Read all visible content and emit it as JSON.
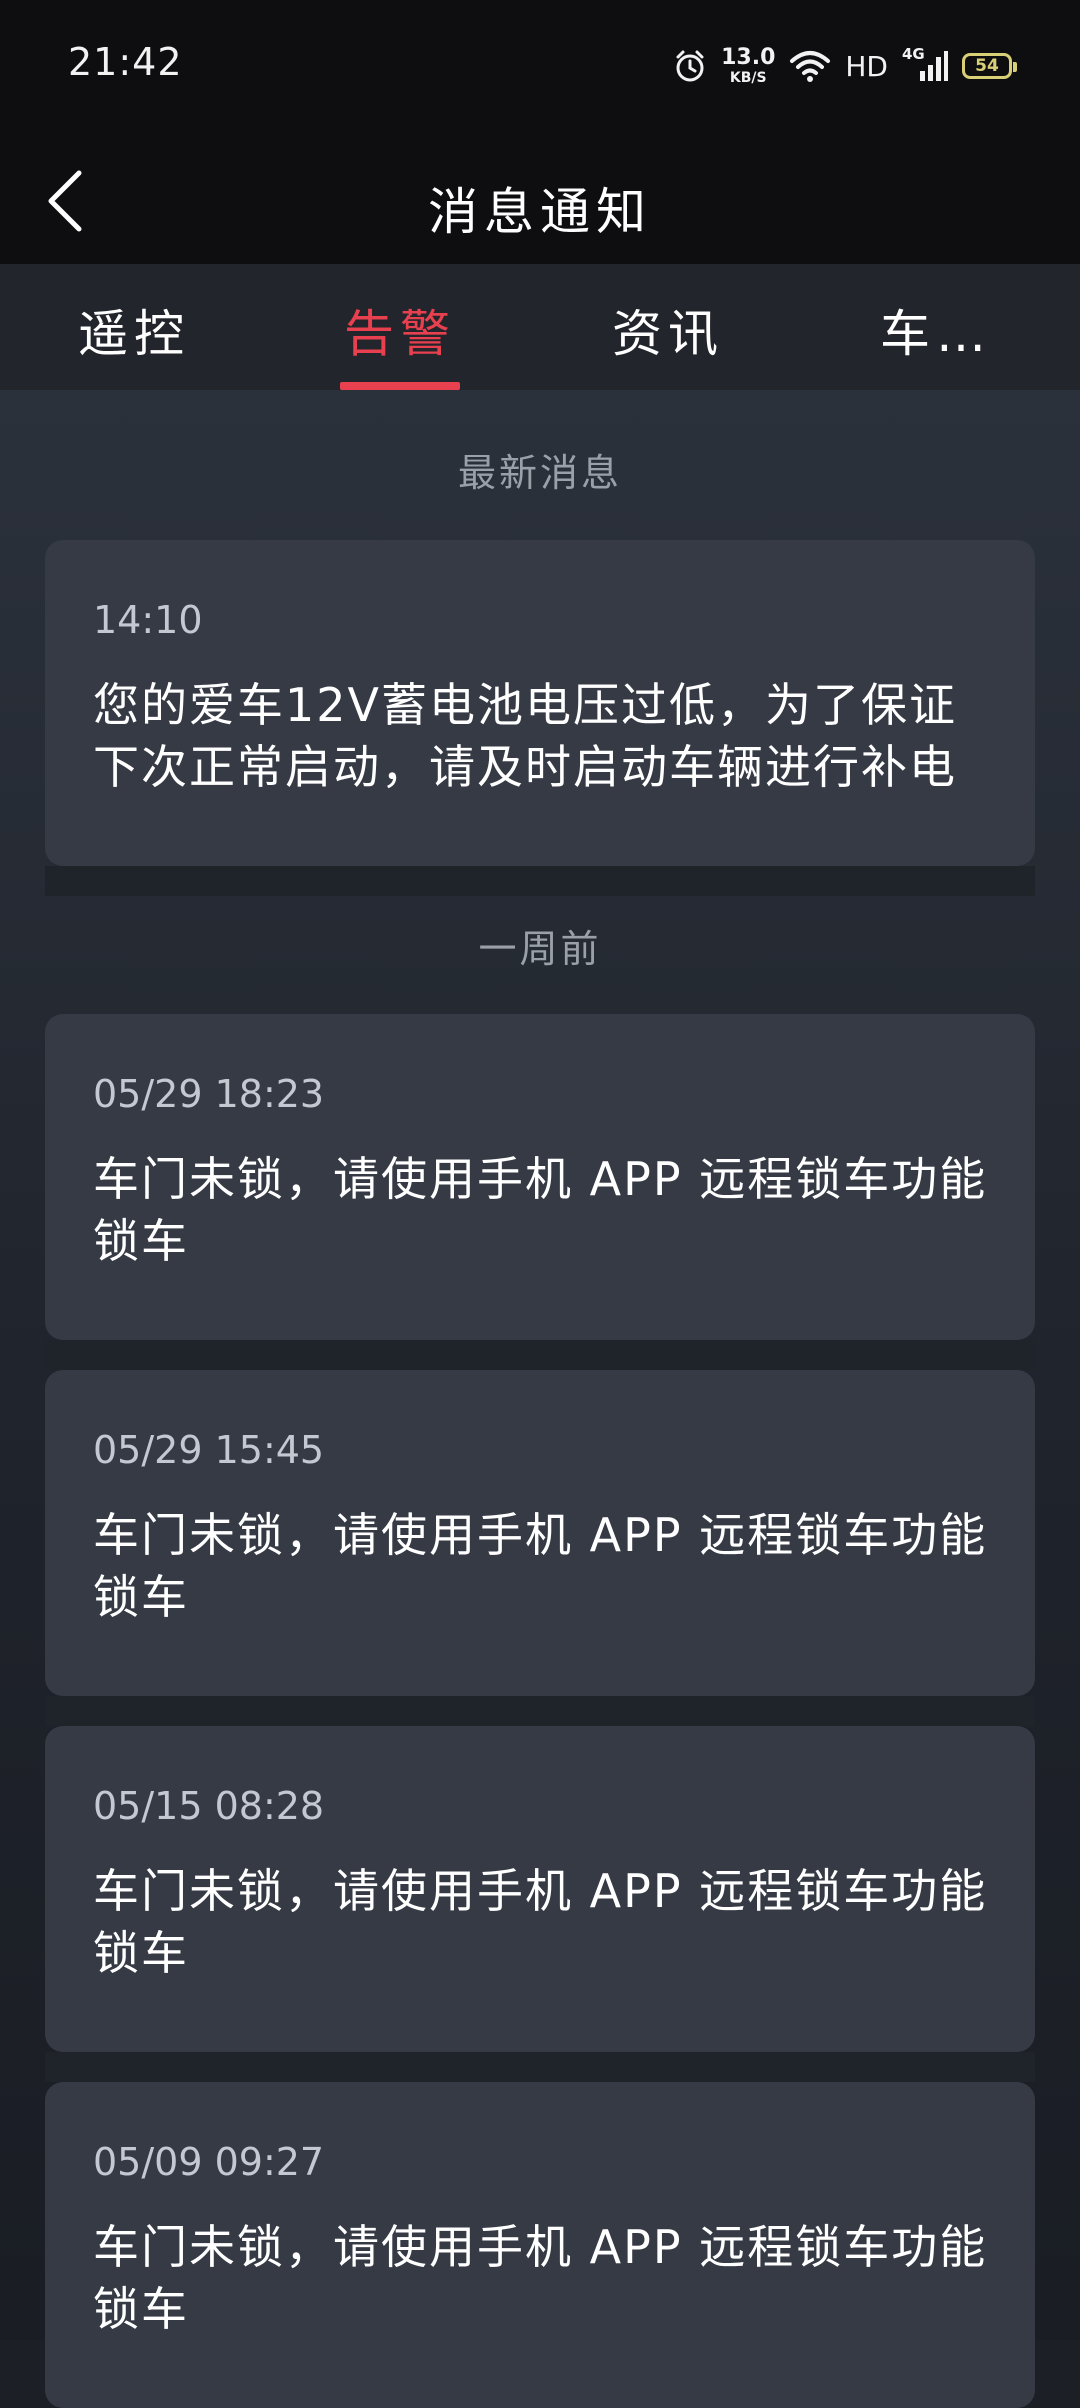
{
  "status": {
    "time": "21:42",
    "net_speed_value": "13.0",
    "net_speed_unit": "KB/S",
    "hd_label": "HD",
    "signal_label": "4G",
    "battery": "54",
    "battery_color": "#d8cf77"
  },
  "nav": {
    "title": "消息通知",
    "back_icon": "chevron-left-icon"
  },
  "tabs": [
    {
      "label": "遥控",
      "active": false
    },
    {
      "label": "告警",
      "active": true
    },
    {
      "label": "资讯",
      "active": false
    },
    {
      "label": "车…",
      "active": false
    }
  ],
  "accent_color": "#e8404f",
  "sections": [
    {
      "header": "最新消息",
      "items": [
        {
          "time": "14:10",
          "message": "您的爱车12V蓄电池电压过低，为了保证下次正常启动，请及时启动车辆进行补电"
        }
      ]
    },
    {
      "header": "一周前",
      "items": [
        {
          "time": "05/29 18:23",
          "message": "车门未锁，请使用手机 APP 远程锁车功能锁车"
        },
        {
          "time": "05/29 15:45",
          "message": "车门未锁，请使用手机 APP 远程锁车功能锁车"
        },
        {
          "time": "05/15 08:28",
          "message": "车门未锁，请使用手机 APP 远程锁车功能锁车"
        },
        {
          "time": "05/09 09:27",
          "message": "车门未锁，请使用手机 APP 远程锁车功能锁车"
        }
      ]
    }
  ]
}
